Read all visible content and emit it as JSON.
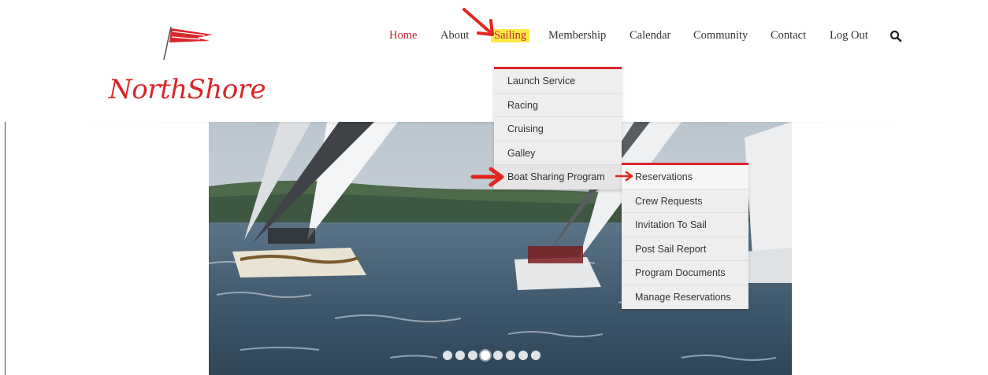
{
  "logo": {
    "text": "NorthShore",
    "color": "#d9262b"
  },
  "nav": {
    "items": [
      {
        "label": "Home",
        "state": "active"
      },
      {
        "label": "About",
        "state": "normal"
      },
      {
        "label": "Sailing",
        "state": "highlighted"
      },
      {
        "label": "Membership",
        "state": "normal"
      },
      {
        "label": "Calendar",
        "state": "normal"
      },
      {
        "label": "Community",
        "state": "normal"
      },
      {
        "label": "Contact",
        "state": "normal"
      },
      {
        "label": "Log Out",
        "state": "normal"
      }
    ],
    "search_icon": "search-icon"
  },
  "sailing_menu": {
    "items": [
      {
        "label": "Launch Service"
      },
      {
        "label": "Racing"
      },
      {
        "label": "Cruising"
      },
      {
        "label": "Galley"
      },
      {
        "label": "Boat Sharing Program"
      }
    ]
  },
  "boat_sharing_menu": {
    "items": [
      {
        "label": "Reservations"
      },
      {
        "label": "Crew Requests"
      },
      {
        "label": "Invitation To Sail"
      },
      {
        "label": "Post Sail Report"
      },
      {
        "label": "Program Documents"
      },
      {
        "label": "Manage Reservations"
      }
    ]
  },
  "slider": {
    "slide_count": 8,
    "active_index": 3
  },
  "colors": {
    "accent": "#d9262b",
    "highlight": "#fde84a",
    "menu_bg": "#efeeee"
  }
}
